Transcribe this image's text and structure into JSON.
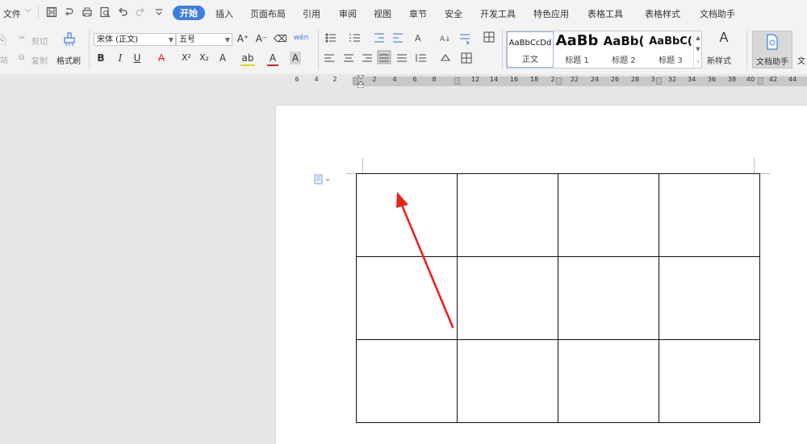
{
  "menu": {
    "file_label": "文件",
    "tabs": [
      "开始",
      "插入",
      "页面布局",
      "引用",
      "审阅",
      "视图",
      "章节",
      "安全",
      "开发工具",
      "特色应用",
      "表格工具",
      "表格样式",
      "文档助手"
    ],
    "active_tab": "开始",
    "quick_icons": [
      "save-icon",
      "cloud-sync-icon",
      "print-icon",
      "print-preview-icon",
      "undo-icon",
      "redo-icon",
      "customize-icon"
    ]
  },
  "ribbon": {
    "clipboard": {
      "cut": "剪切",
      "copy": "复制",
      "paste_fragment": "站",
      "format_painter": "格式刷"
    },
    "font": {
      "font_name": "宋体 (正文)",
      "font_size": "五号",
      "grow": "A⁺",
      "shrink": "A⁻",
      "bold": "B",
      "italic": "I",
      "underline": "U",
      "strikethrough": "A",
      "superscript": "X²",
      "subscript": "X₂",
      "text_effect": "A",
      "highlight": "ab",
      "font_color": "A",
      "char_shading": "A",
      "phonetic": "wén"
    },
    "styles": [
      {
        "sample": "AaBbCcDd",
        "name": "正文"
      },
      {
        "sample": "AaBb",
        "name": "标题 1"
      },
      {
        "sample": "AaBb(",
        "name": "标题 2"
      },
      {
        "sample": "AaBbC(",
        "name": "标题 3"
      }
    ],
    "new_style": "新样式",
    "assistant": "文档助手",
    "assistant_cut": "文"
  },
  "ruler": {
    "numbers": [
      "6",
      "4",
      "2",
      "2",
      "2",
      "4",
      "6",
      "8",
      "12",
      "14",
      "16",
      "18",
      "2",
      "22",
      "24",
      "26",
      "28",
      "3",
      "32",
      "34",
      "36",
      "38",
      "40",
      "42",
      "44"
    ]
  },
  "document": {
    "table": {
      "rows": 3,
      "cols": 4
    }
  },
  "colors": {
    "accent": "#3c7de1",
    "arrow": "#e8231b",
    "page": "#ffffff",
    "workspace": "#e6e6e6"
  }
}
